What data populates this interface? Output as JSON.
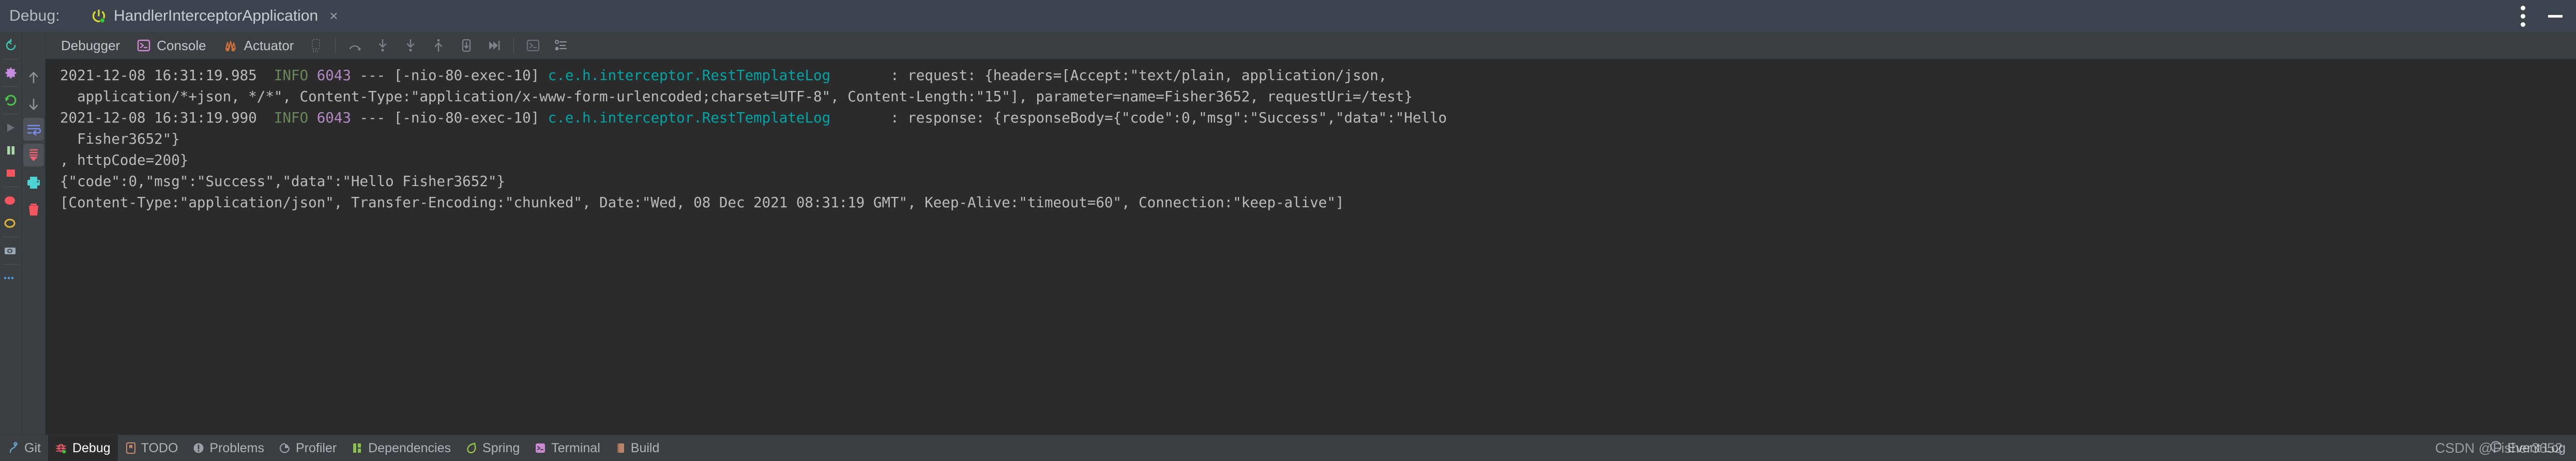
{
  "window": {
    "debug_label": "Debug:",
    "run_config_name": "HandlerInterceptorApplication",
    "close_glyph": "×"
  },
  "tabs": [
    {
      "label": "Debugger",
      "icon": "debugger-icon"
    },
    {
      "label": "Console",
      "icon": "console-icon"
    },
    {
      "label": "Actuator",
      "icon": "actuator-icon"
    }
  ],
  "toolbar_buttons": [
    {
      "name": "mute-breakpoints-icon"
    },
    {
      "name": "step-over-icon"
    },
    {
      "name": "step-into-icon"
    },
    {
      "name": "force-step-into-icon"
    },
    {
      "name": "step-out-icon"
    },
    {
      "name": "drop-frame-icon"
    },
    {
      "name": "run-to-cursor-icon"
    },
    {
      "name": "evaluate-expression-icon"
    },
    {
      "name": "threads-view-icon"
    }
  ],
  "gutter_icons": [
    {
      "name": "rerun-icon"
    },
    {
      "name": "settings-gear-icon"
    },
    {
      "name": "restart-icon"
    },
    {
      "name": "resume-program-icon"
    },
    {
      "name": "pause-program-icon"
    },
    {
      "name": "stop-program-icon"
    },
    {
      "name": "view-breakpoints-icon"
    },
    {
      "name": "mute-breakpoints-ring-icon"
    },
    {
      "name": "camera-icon"
    },
    {
      "name": "more-options-icon"
    }
  ],
  "vtoolbar_icons": [
    {
      "name": "scroll-up-icon"
    },
    {
      "name": "scroll-down-icon"
    },
    {
      "name": "soft-wrap-icon"
    },
    {
      "name": "scroll-to-end-icon"
    },
    {
      "name": "print-icon"
    },
    {
      "name": "clear-all-icon"
    }
  ],
  "console": {
    "lines": [
      {
        "id": "log-line-1",
        "segments": [
          {
            "text": "2021-12-08 16:31:19.985  ",
            "color": "plain"
          },
          {
            "text": "INFO",
            "color": "info"
          },
          {
            "text": " ",
            "color": "plain"
          },
          {
            "text": "6043",
            "color": "pid"
          },
          {
            "text": " --- [-nio-80-exec-10] ",
            "color": "plain"
          },
          {
            "text": "c.e.h.interceptor.RestTemplateLog",
            "color": "logger"
          },
          {
            "text": "       : request: {headers=[Accept:\"text/plain, application/json,",
            "color": "plain"
          }
        ]
      },
      {
        "id": "log-line-2",
        "segments": [
          {
            "text": "  application/*+json, */*\", Content-Type:\"application/x-www-form-urlencoded;charset=UTF-8\", Content-Length:\"15\"], parameter=name=Fisher3652, requestUri=/test}",
            "color": "plain"
          }
        ]
      },
      {
        "id": "log-line-3",
        "segments": [
          {
            "text": "2021-12-08 16:31:19.990  ",
            "color": "plain"
          },
          {
            "text": "INFO",
            "color": "info"
          },
          {
            "text": " ",
            "color": "plain"
          },
          {
            "text": "6043",
            "color": "pid"
          },
          {
            "text": " --- [-nio-80-exec-10] ",
            "color": "plain"
          },
          {
            "text": "c.e.h.interceptor.RestTemplateLog",
            "color": "logger"
          },
          {
            "text": "       : response: {responseBody={\"code\":0,\"msg\":\"Success\",\"data\":\"Hello",
            "color": "plain"
          }
        ]
      },
      {
        "id": "log-line-4",
        "segments": [
          {
            "text": "  Fisher3652\"}",
            "color": "plain"
          }
        ]
      },
      {
        "id": "log-line-5",
        "segments": [
          {
            "text": ", httpCode=200}",
            "color": "plain"
          }
        ]
      },
      {
        "id": "log-line-6",
        "segments": [
          {
            "text": "{\"code\":0,\"msg\":\"Success\",\"data\":\"Hello Fisher3652\"}",
            "color": "plain"
          }
        ]
      },
      {
        "id": "log-line-7",
        "segments": [
          {
            "text": "[Content-Type:\"application/json\", Transfer-Encoding:\"chunked\", Date:\"Wed, 08 Dec 2021 08:31:19 GMT\", Keep-Alive:\"timeout=60\", Connection:\"keep-alive\"]",
            "color": "plain"
          }
        ]
      }
    ]
  },
  "statusbar": {
    "items": [
      {
        "label": "Git",
        "icon": "git-icon",
        "active": false
      },
      {
        "label": "Debug",
        "icon": "debug-bug-icon",
        "active": true
      },
      {
        "label": "TODO",
        "icon": "todo-icon",
        "active": false
      },
      {
        "label": "Problems",
        "icon": "problems-icon",
        "active": false
      },
      {
        "label": "Profiler",
        "icon": "profiler-icon",
        "active": false
      },
      {
        "label": "Dependencies",
        "icon": "dependencies-icon",
        "active": false
      },
      {
        "label": "Spring",
        "icon": "spring-leaf-icon",
        "active": false
      },
      {
        "label": "Terminal",
        "icon": "terminal-icon",
        "active": false
      },
      {
        "label": "Build",
        "icon": "build-icon",
        "active": false
      }
    ],
    "event_log_label": "Event Log",
    "event_log_icon": "event-log-icon"
  },
  "watermark": {
    "text": "CSDN @Fisher3652"
  },
  "colors": {
    "tabbar_bg": "#3d4450",
    "panel_bg": "#3c3f41",
    "console_bg": "#2b2b2b",
    "text": "#bbbbbb",
    "info_green": "#6a8759",
    "pid_purple": "#b389c5",
    "logger_teal": "#00a6a6",
    "accent_blue": "#7a86c8"
  }
}
